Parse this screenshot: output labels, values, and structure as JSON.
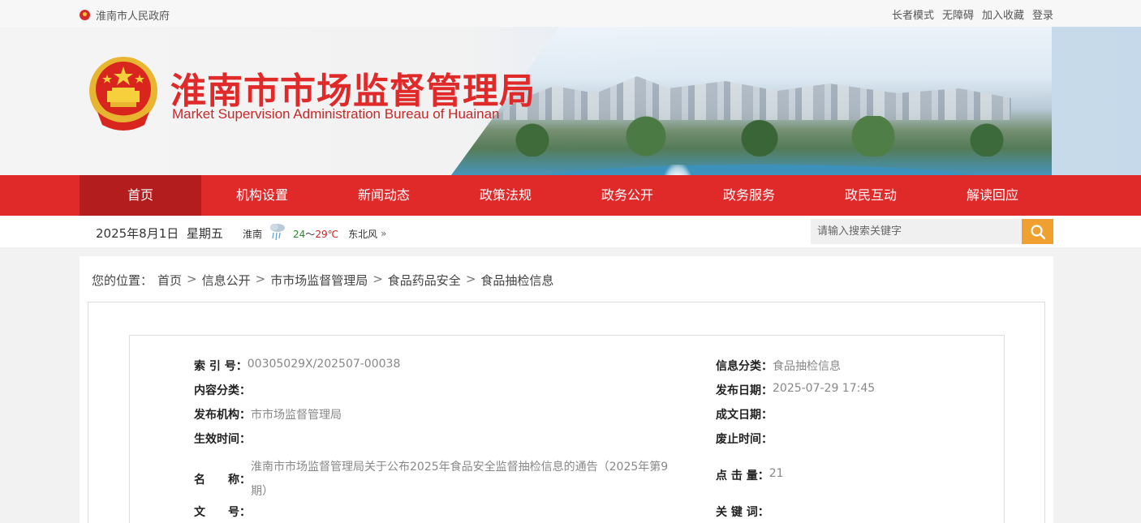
{
  "topbar": {
    "gov_link": "淮南市人民政府",
    "links": [
      "长者模式",
      "无障碍",
      "加入收藏",
      "登录"
    ]
  },
  "header": {
    "title": "淮南市市场监督管理局",
    "subtitle": "Market Supervision Administration Bureau of Huainan"
  },
  "nav": {
    "items": [
      "首页",
      "机构设置",
      "新闻动态",
      "政策法规",
      "政务公开",
      "政务服务",
      "政民互动",
      "解读回应"
    ],
    "active_index": 0
  },
  "infobar": {
    "date": "2025年8月1日",
    "weekday": "星期五",
    "city": "淮南",
    "temp_low": "24",
    "temp_sep": "～",
    "temp_high": "29℃",
    "wind": "东北风",
    "more": "»"
  },
  "search": {
    "placeholder": "请输入搜索关键字",
    "icon": "search-icon"
  },
  "breadcrumb": {
    "prefix": "您的位置：",
    "items": [
      "首页",
      "信息公开",
      "市市场监督管理局",
      "食品药品安全",
      "食品抽检信息"
    ],
    "separator": ">"
  },
  "meta": {
    "index_no_label": "索 引 号：",
    "index_no": "00305029X/202507-00038",
    "info_category_label": "信息分类：",
    "info_category": "食品抽检信息",
    "content_category_label": "内容分类：",
    "content_category": "",
    "publish_date_label": "发布日期：",
    "publish_date": "2025-07-29 17:45",
    "publisher_label": "发布机构：",
    "publisher": "市市场监督管理局",
    "doc_date_label": "成文日期：",
    "doc_date": "",
    "effective_label": "生效时间：",
    "effective": "",
    "expire_label": "废止时间：",
    "expire": "",
    "name_label": "名　　称：",
    "name": "淮南市市场监督管理局关于公布2025年食品安全监督抽检信息的通告（2025年第9期）",
    "clicks_label": "点 击 量：",
    "clicks": "21",
    "doc_no_label": "文　　号：",
    "doc_no": "",
    "keywords_label": "关 键 词：",
    "keywords": ""
  },
  "colors": {
    "brand_red": "#e02a2a",
    "nav_active": "#b41d1d",
    "search_button": "#f0a030"
  }
}
